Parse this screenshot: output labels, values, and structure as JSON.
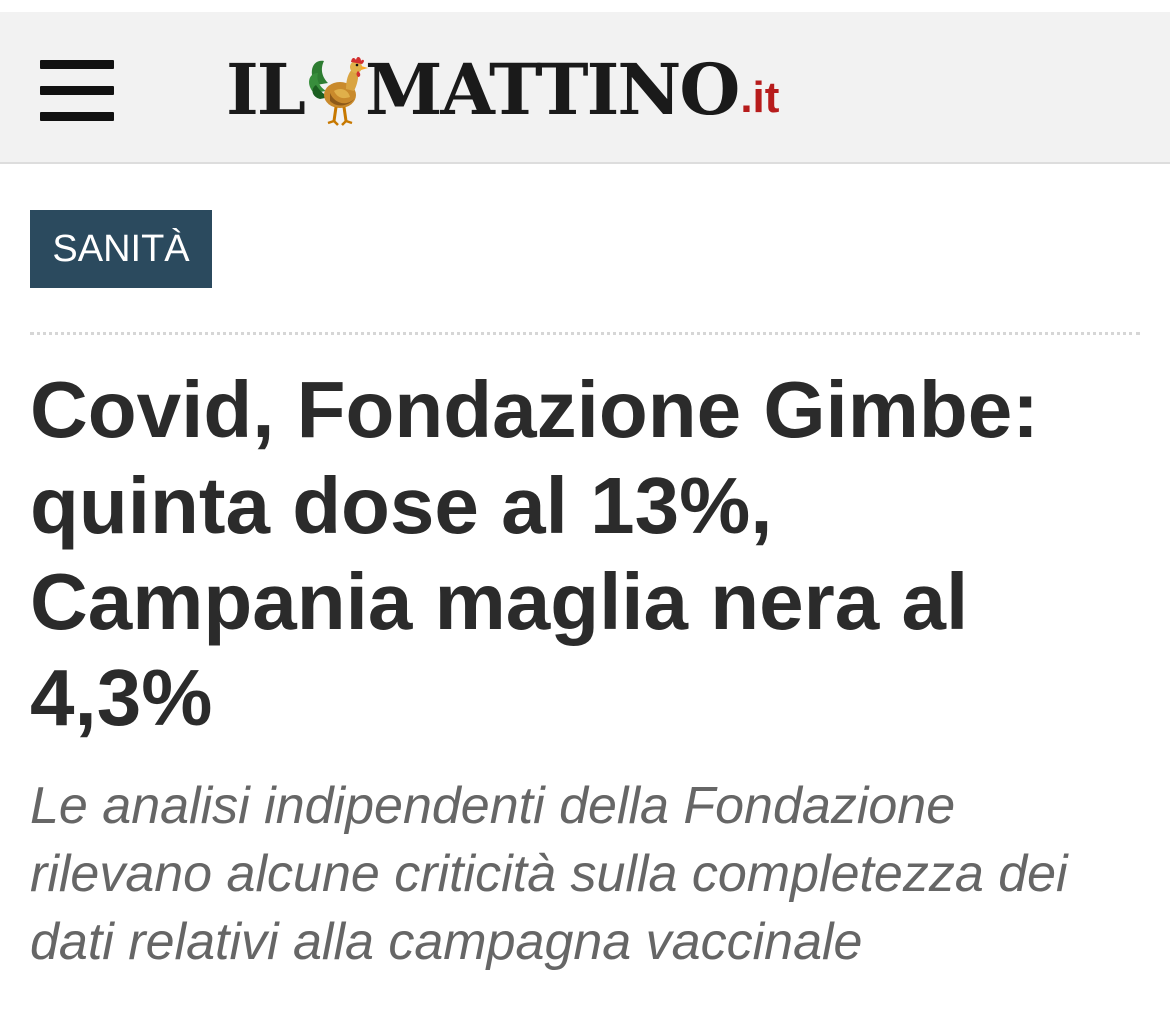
{
  "header": {
    "menu_icon": "hamburger-menu-icon",
    "logo": {
      "word_left": "IL",
      "word_right": "MATTINO",
      "tld": ".it",
      "mascot_icon": "rooster-icon",
      "tld_color": "#b71c1c"
    }
  },
  "article": {
    "category": "SANITÀ",
    "headline": "Covid, Fondazione Gimbe: quinta dose al 13%, Campania maglia nera al 4,3%",
    "subtitle": "Le analisi indipendenti della Fondazione rilevano alcune criticità sulla completezza dei dati relativi alla campagna vaccinale"
  },
  "colors": {
    "header_background": "#f2f2f2",
    "category_badge": "#2b4a5e",
    "headline_text": "#2b2b2b",
    "subtitle_text": "#666666"
  }
}
